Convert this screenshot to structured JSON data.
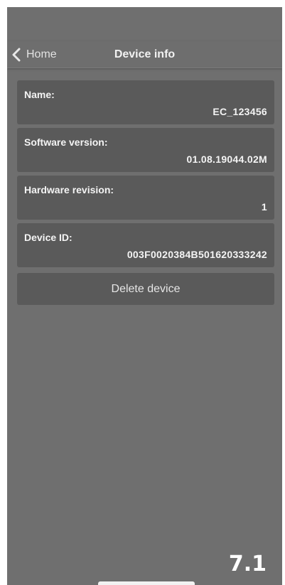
{
  "nav": {
    "back_label": "Home",
    "title": "Device info"
  },
  "fields": [
    {
      "label": "Name:",
      "value": "EC_123456"
    },
    {
      "label": "Software version:",
      "value": "01.08.19044.02M"
    },
    {
      "label": "Hardware revision:",
      "value": "1"
    },
    {
      "label": "Device ID:",
      "value": "003F0020384B501620333242"
    }
  ],
  "actions": {
    "delete_label": "Delete device"
  },
  "overlay": {
    "step": "7.1"
  },
  "icons": {
    "back": "chevron-left-icon"
  },
  "colors": {
    "background": "#6f6f6f",
    "card": "#5a5a5a",
    "text": "#f4f4f4"
  }
}
